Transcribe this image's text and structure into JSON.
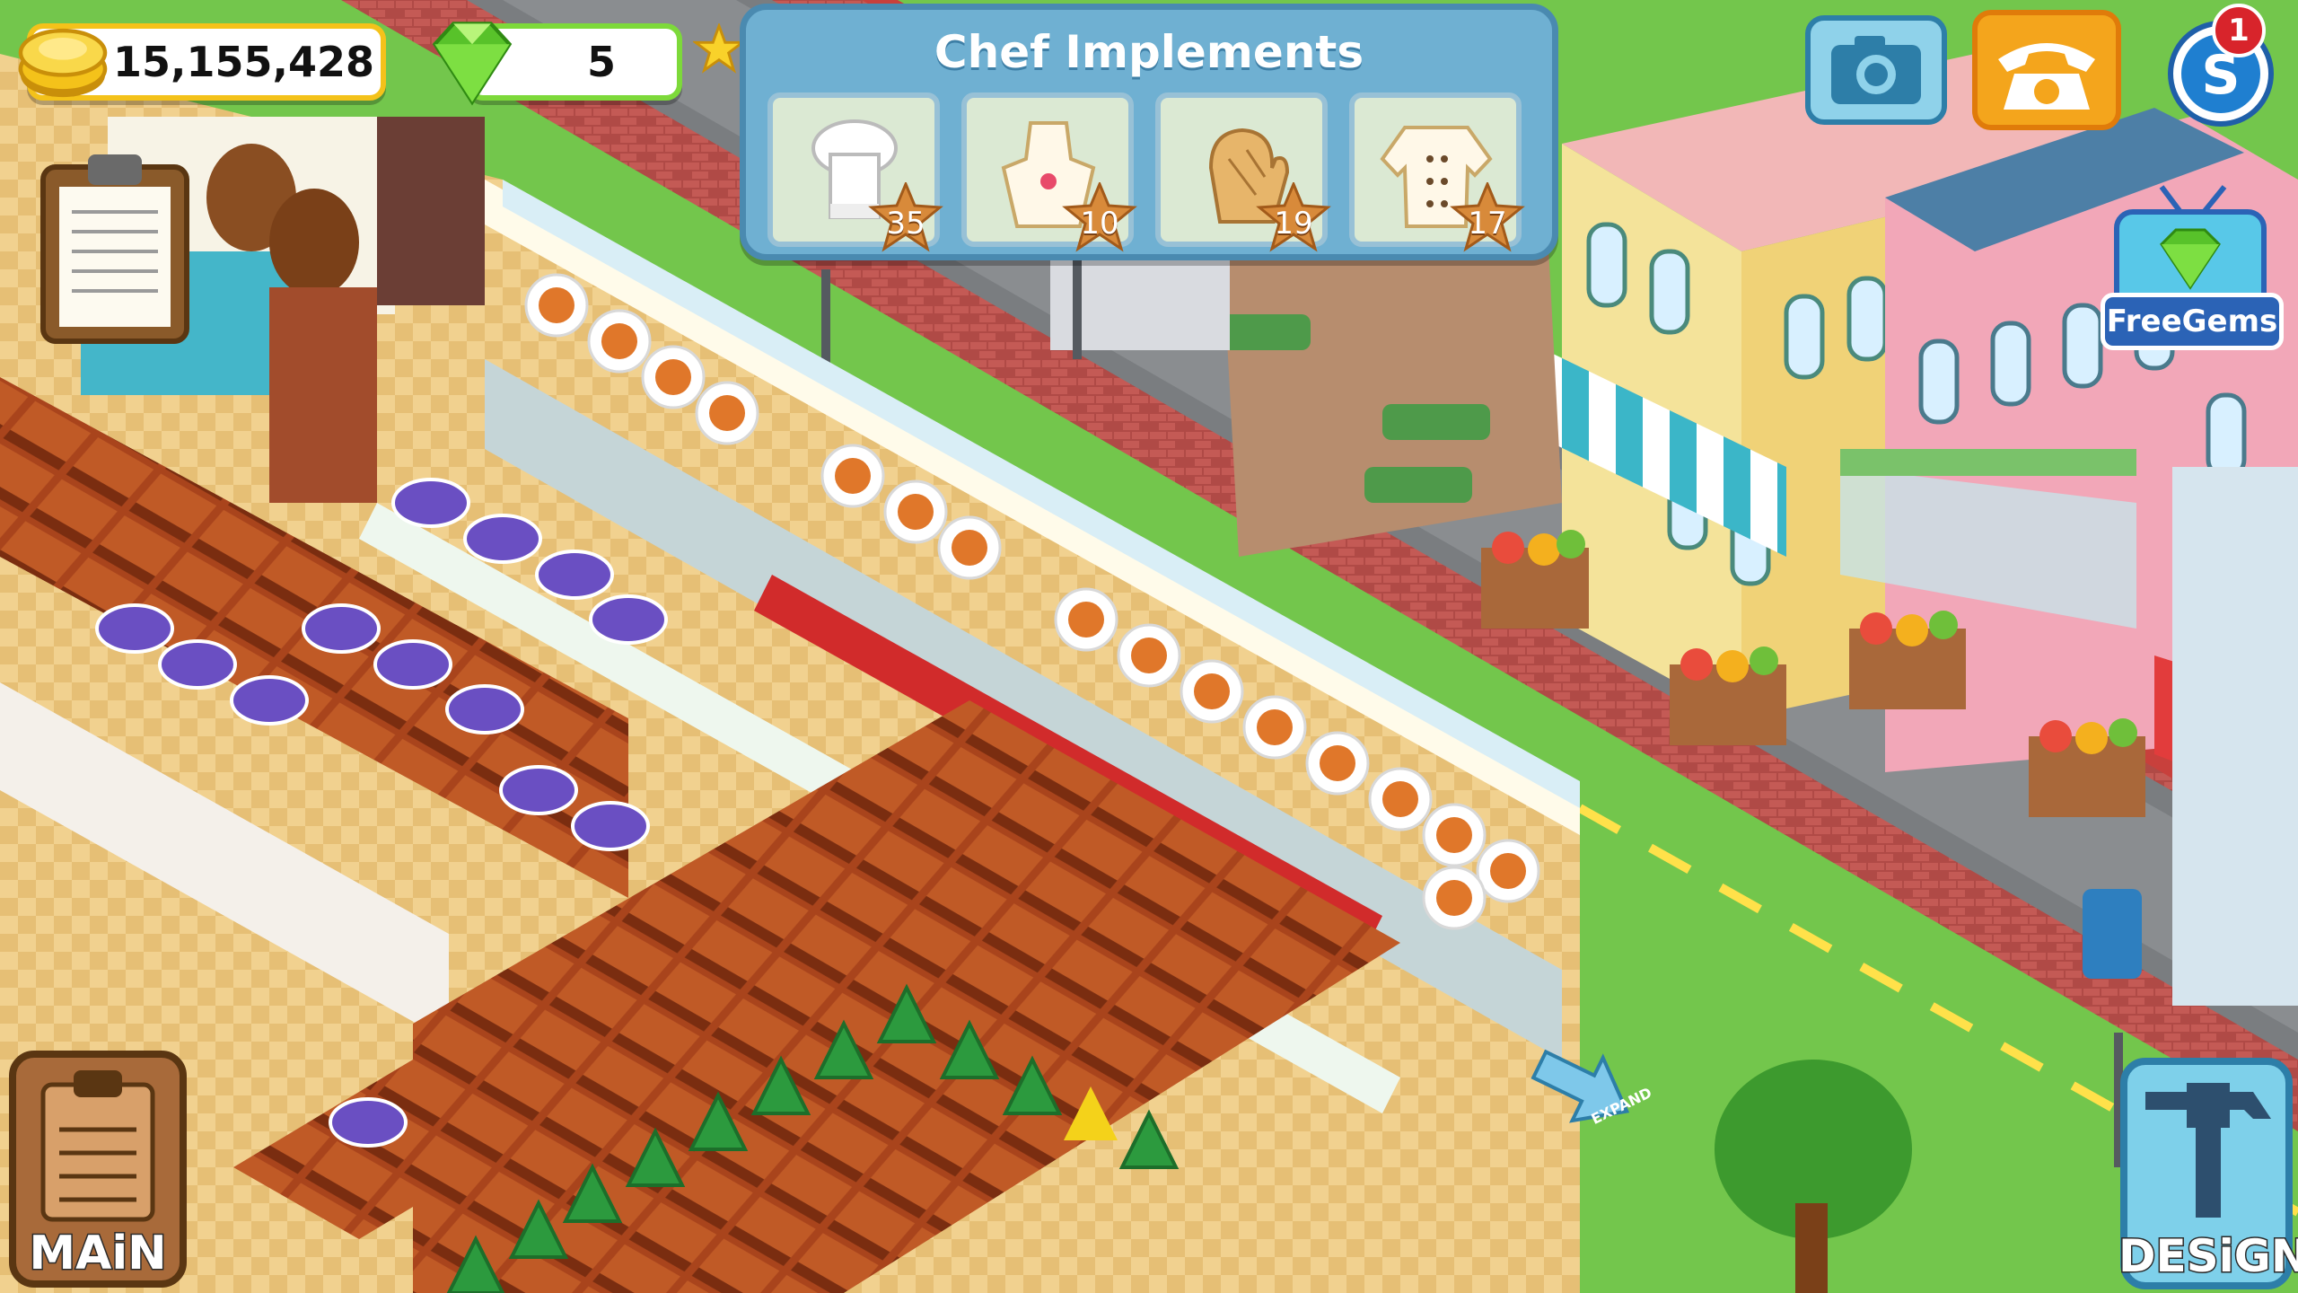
{
  "hud": {
    "coins": "15,155,428",
    "gems": "5",
    "notification_count": "1",
    "free_gems_label": "FreeGems",
    "expand_label": "EXPAND"
  },
  "panel": {
    "title": "Chef Implements",
    "items": [
      {
        "name": "chef-hat",
        "count": "35"
      },
      {
        "name": "apron",
        "count": "10"
      },
      {
        "name": "oven-mitt",
        "count": "19"
      },
      {
        "name": "chef-jacket",
        "count": "17"
      }
    ]
  },
  "buttons": {
    "main": "MAiN",
    "design": "DESiGN"
  },
  "icons": [
    "coin-stack-icon",
    "gem-icon",
    "star-icon",
    "clipboard-icon",
    "camera-icon",
    "phone-icon",
    "social-icon",
    "tv-gem-icon",
    "hammer-icon",
    "expand-arrow-icon"
  ],
  "colors": {
    "accent_gold": "#f4c21a",
    "gem_green": "#7dd93a",
    "panel_blue": "#6fb0d2",
    "free_gems_blue": "#2b63b6"
  }
}
